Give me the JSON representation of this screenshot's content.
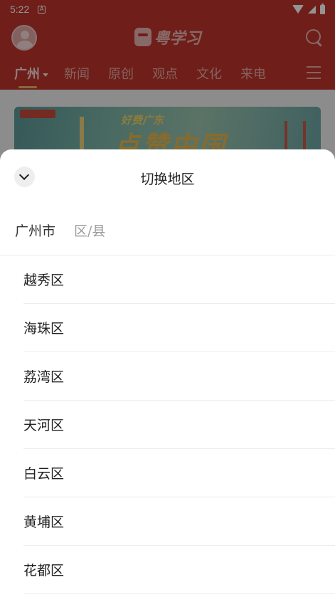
{
  "status_bar": {
    "time": "5:22",
    "notification_icon": "a-box-icon",
    "wifi_icon": "wifi-icon",
    "signal_icon": "signal-icon",
    "battery_icon": "battery-icon"
  },
  "app_header": {
    "logo_text": "粤学习"
  },
  "channels": {
    "items": [
      {
        "label": "广州",
        "active": true
      },
      {
        "label": "新闻",
        "active": false
      },
      {
        "label": "原创",
        "active": false
      },
      {
        "label": "观点",
        "active": false
      },
      {
        "label": "文化",
        "active": false
      },
      {
        "label": "来电",
        "active": false
      }
    ]
  },
  "banner": {
    "subtitle": "好费广东",
    "title": "点赞中国"
  },
  "sheet": {
    "title": "切换地区",
    "level_tabs": {
      "city": "广州市",
      "district": "区/县"
    },
    "districts": [
      "越秀区",
      "海珠区",
      "荔湾区",
      "天河区",
      "白云区",
      "黄埔区",
      "花都区"
    ]
  },
  "colors": {
    "brand_red": "#c0342c",
    "active_underline": "#e6b766",
    "overlay": "rgba(0,0,0,0.42)"
  }
}
